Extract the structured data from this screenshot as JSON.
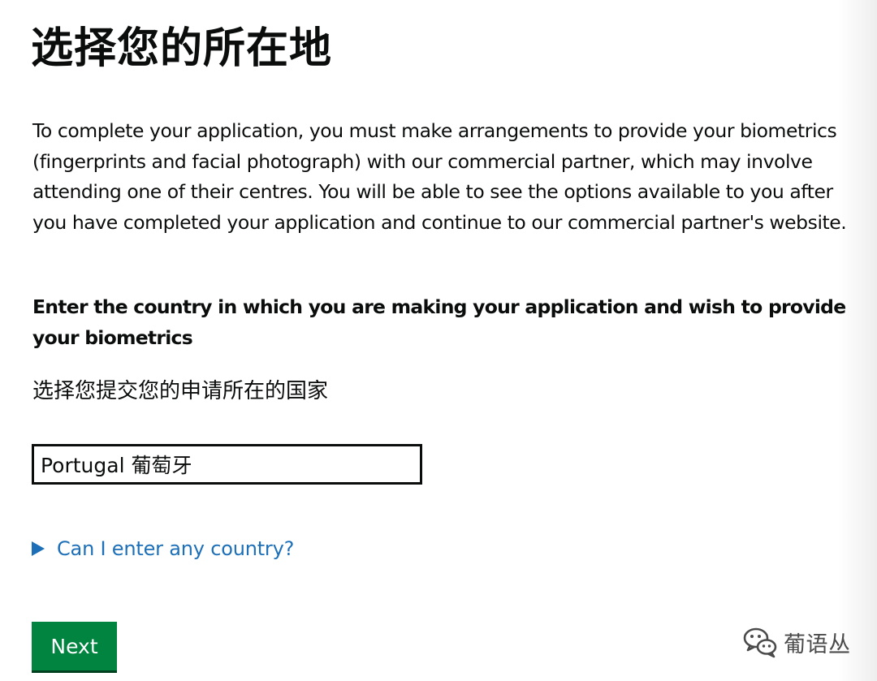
{
  "page": {
    "title": "选择您的所在地",
    "intro": "To complete your application, you must make arrangements to provide your biometrics (fingerprints and facial photograph) with our commercial partner, which may involve attending one of their centres. You will be able to see the options available to you after you have completed your application and continue to our commercial partner's website."
  },
  "form": {
    "question": "Enter the country in which you are making your application and wish to provide your biometrics",
    "hint": "选择您提交您的申请所在的国家",
    "country_value": "Portugal 葡萄牙"
  },
  "details": {
    "summary": "Can I enter any country?"
  },
  "actions": {
    "next_label": "Next"
  },
  "watermark": {
    "icon": "wechat-icon",
    "text": "葡语丛"
  },
  "colors": {
    "text": "#0b0c0c",
    "link": "#1d70b8",
    "button": "#00843f",
    "button_shadow": "#00401e",
    "watermark": "#4b4b4b"
  }
}
